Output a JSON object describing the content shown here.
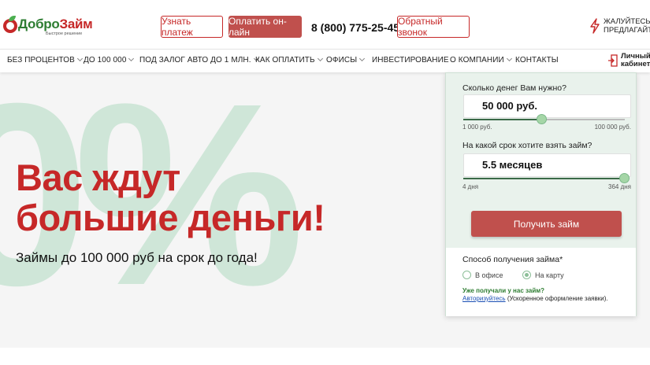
{
  "header": {
    "logo": {
      "part1": "Добро",
      "part2": "Займ",
      "tagline": "Быстрое решение"
    },
    "learn_payment": "Узнать платеж",
    "pay_online": "Оплатить он-лайн",
    "phone": "8 (800) 775-25-45",
    "callback": "Обратный звонок",
    "complain_line1": "ЖАЛУЙТЕСЬ И",
    "complain_line2": "ПРЕДЛАГАЙТЕ",
    "complain_icon": "lightning-icon"
  },
  "nav": {
    "items": [
      {
        "label": "БЕЗ ПРОЦЕНТОВ",
        "dropdown": true
      },
      {
        "label": "ДО 100 000",
        "dropdown": true
      },
      {
        "label": "ПОД ЗАЛОГ АВТО ДО 1 МЛН.",
        "dropdown": true
      },
      {
        "label": "КАК ОПЛАТИТЬ",
        "dropdown": true
      },
      {
        "label": "ОФИСЫ",
        "dropdown": true
      },
      {
        "label": "ИНВЕСТИРОВАНИЕ",
        "dropdown": false
      },
      {
        "label": "О КОМПАНИИ",
        "dropdown": true
      },
      {
        "label": "КОНТАКТЫ",
        "dropdown": false
      }
    ],
    "cabinet_line1": "Личный",
    "cabinet_line2": "кабинет",
    "cabinet_icon": "login-icon"
  },
  "hero": {
    "background_text": "0%",
    "title_line1": "Вас ждут",
    "title_line2": "большие деньги!",
    "subtitle": "Займы до 100 000 руб на срок до года!"
  },
  "calculator": {
    "amount_label": "Сколько денег Вам нужно?",
    "amount_value": "50 000 руб.",
    "amount_min": "1 000 руб.",
    "amount_max": "100 000 руб.",
    "amount_fraction": 0.49,
    "term_label": "На какой срок хотите взять займ?",
    "term_value": "5.5 месяцев",
    "term_min": "4 дня",
    "term_max": "364 дня",
    "term_fraction": 1.0,
    "submit": "Получить займ",
    "method_label": "Способ получения займа*",
    "method_options": [
      {
        "label": "В офисе",
        "selected": false
      },
      {
        "label": "На карту",
        "selected": true
      }
    ],
    "already_text": "Уже получали у нас займ?",
    "auth_link": "Авторизуйтесь",
    "auth_rest": " (Ускоренное оформление заявки)."
  },
  "colors": {
    "brand_red": "#c62828",
    "button_red": "#c0504d",
    "brand_green": "#2e7d32",
    "mint": "#cfe6d8"
  }
}
